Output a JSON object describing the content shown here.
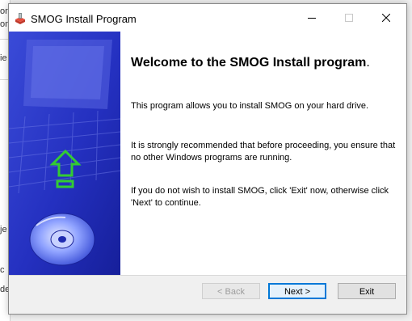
{
  "background": {
    "fragments": [
      "or",
      "on",
      "ie",
      "je",
      "c",
      "de"
    ]
  },
  "window": {
    "title": "SMOG Install Program",
    "controls": {
      "minimize": "minimize",
      "maximize": "maximize",
      "close": "close"
    }
  },
  "content": {
    "heading": "Welcome to the SMOG Install program",
    "heading_suffix": ".",
    "paragraphs": [
      "This program allows you to install SMOG on your hard drive.",
      "It is strongly recommended that before proceeding, you ensure that no other Windows programs are running.",
      "If you do not wish to install SMOG, click 'Exit' now, otherwise click 'Next' to continue."
    ]
  },
  "buttons": {
    "back": "< Back",
    "next": "Next >",
    "exit": "Exit"
  },
  "colors": {
    "panel_blue": "#2a36c8",
    "arrow_green": "#33cc33",
    "title_bar": "#ffffff"
  },
  "icons": {
    "app": "installer-icon",
    "minimize": "minimize-icon",
    "maximize": "maximize-icon",
    "close": "close-icon",
    "arrow": "up-arrow-icon",
    "disc": "cd-disc-icon"
  }
}
